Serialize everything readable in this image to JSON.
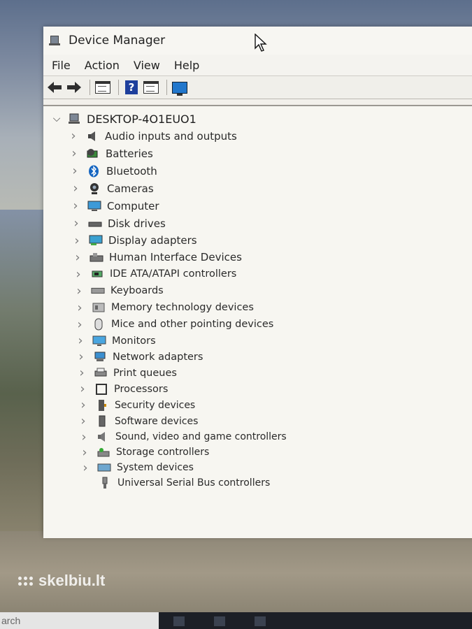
{
  "window": {
    "title": "Device Manager",
    "menu": [
      "File",
      "Action",
      "View",
      "Help"
    ],
    "toolbar": {
      "buttons": [
        "back-icon",
        "forward-icon",
        "properties-icon",
        "help-icon",
        "show-hidden-icon",
        "scan-hardware-icon"
      ]
    }
  },
  "tree": {
    "root": "DESKTOP-4O1EUO1",
    "items": [
      {
        "label": "Audio inputs and outputs",
        "icon": "speaker-icon"
      },
      {
        "label": "Batteries",
        "icon": "battery-icon"
      },
      {
        "label": "Bluetooth",
        "icon": "bluetooth-icon"
      },
      {
        "label": "Cameras",
        "icon": "camera-icon"
      },
      {
        "label": "Computer",
        "icon": "computer-icon"
      },
      {
        "label": "Disk drives",
        "icon": "disk-drive-icon"
      },
      {
        "label": "Display adapters",
        "icon": "display-adapter-icon"
      },
      {
        "label": "Human Interface Devices",
        "icon": "hid-icon"
      },
      {
        "label": "IDE ATA/ATAPI controllers",
        "icon": "ide-controller-icon"
      },
      {
        "label": "Keyboards",
        "icon": "keyboard-icon"
      },
      {
        "label": "Memory technology devices",
        "icon": "memory-icon"
      },
      {
        "label": "Mice and other pointing devices",
        "icon": "mouse-icon"
      },
      {
        "label": "Monitors",
        "icon": "monitor-icon"
      },
      {
        "label": "Network adapters",
        "icon": "network-adapter-icon"
      },
      {
        "label": "Print queues",
        "icon": "printer-icon"
      },
      {
        "label": "Processors",
        "icon": "processor-icon"
      },
      {
        "label": "Security devices",
        "icon": "security-device-icon"
      },
      {
        "label": "Software devices",
        "icon": "software-device-icon"
      },
      {
        "label": "Sound, video and game controllers",
        "icon": "sound-controller-icon"
      },
      {
        "label": "Storage controllers",
        "icon": "storage-controller-icon"
      },
      {
        "label": "System devices",
        "icon": "system-devices-icon"
      },
      {
        "label": "Universal Serial Bus controllers",
        "icon": "usb-icon"
      }
    ]
  },
  "watermark": "skelbiu.lt",
  "taskbar": {
    "search_text": "arch"
  }
}
